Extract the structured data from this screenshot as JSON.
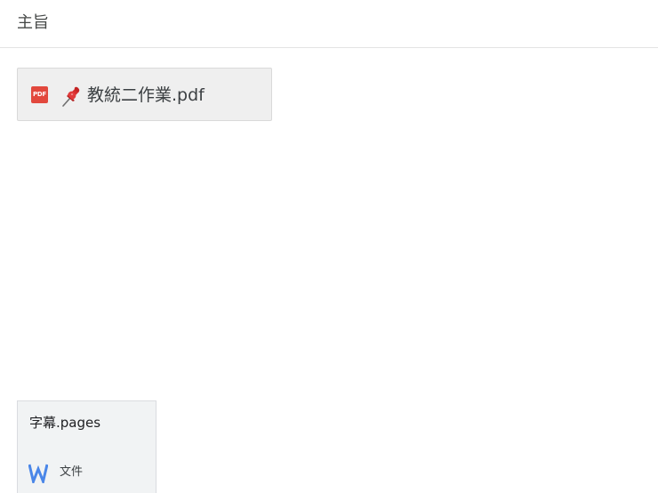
{
  "header": {
    "title": "主旨"
  },
  "attachment": {
    "file_icon": "pdf-icon",
    "file_icon_label": "PDF",
    "pin_icon": "pushpin-icon",
    "name": "教統二作業.pdf"
  },
  "document_card": {
    "name": "字幕.pages",
    "type_icon": "word-document-icon",
    "type_label": "文件"
  },
  "colors": {
    "pdf_red": "#e2483d",
    "doc_blue": "#4a86e8",
    "pin_red": "#d62d2d",
    "card_background": "#efefef"
  }
}
